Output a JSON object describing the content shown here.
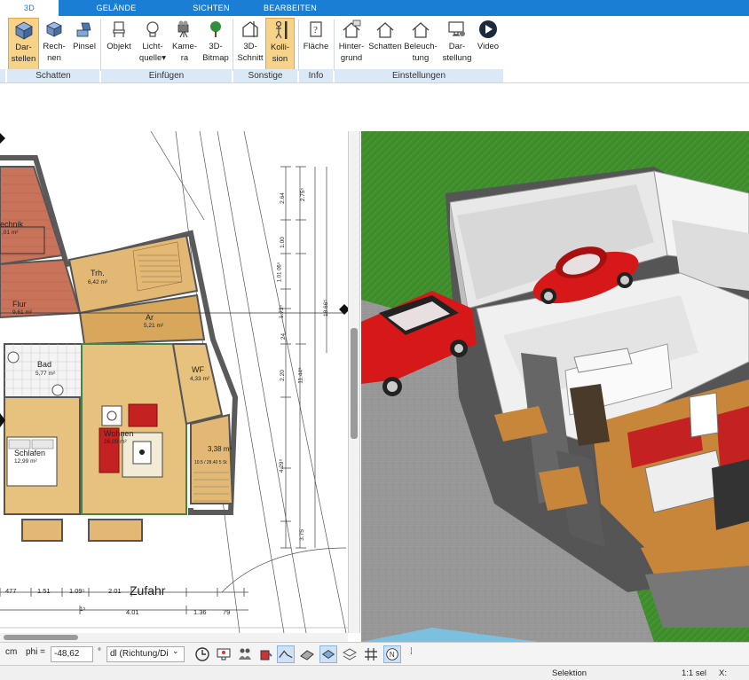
{
  "tabs": [
    {
      "label": "3D",
      "active": true
    },
    {
      "label": "GELÄNDE"
    },
    {
      "label": "SICHTEN"
    },
    {
      "label": "BEARBEITEN"
    }
  ],
  "ribbon": {
    "buttons": [
      {
        "label1": "Dar-",
        "label2": "stellen",
        "icon": "cube-icon",
        "selected": true
      },
      {
        "label1": "Rech-",
        "label2": "nen",
        "icon": "cube-render-icon"
      },
      {
        "label1": "Pinsel",
        "label2": "",
        "icon": "brush-icon"
      },
      {
        "label1": "Objekt",
        "label2": "",
        "icon": "chair-icon"
      },
      {
        "label1": "Licht-",
        "label2": "quelle",
        "icon": "lightbulb-icon"
      },
      {
        "label1": "Kame-",
        "label2": "ra",
        "icon": "camera-icon"
      },
      {
        "label1": "3D-",
        "label2": "Bitmap",
        "icon": "tree-icon"
      },
      {
        "label1": "3D-",
        "label2": "Schnitt",
        "icon": "section-icon"
      },
      {
        "label1": "Kolli-",
        "label2": "sion",
        "icon": "person-collision-icon",
        "selected": true
      },
      {
        "label1": "Fläche",
        "label2": "",
        "icon": "area-info-icon"
      },
      {
        "label1": "Hinter-",
        "label2": "grund",
        "icon": "house-background-icon"
      },
      {
        "label1": "Schatten",
        "label2": "",
        "icon": "house-shadow-icon"
      },
      {
        "label1": "Beleuch-",
        "label2": "tung",
        "icon": "house-light-icon"
      },
      {
        "label1": "Dar-",
        "label2": "stellung",
        "icon": "monitor-settings-icon"
      },
      {
        "label1": "Video",
        "label2": "",
        "icon": "play-icon"
      }
    ],
    "groups": [
      "Schatten",
      "Einfügen",
      "Sonstige",
      "Info",
      "Einstellungen"
    ]
  },
  "plan": {
    "rooms": [
      {
        "name": "echnik",
        "area": ",01 m²"
      },
      {
        "name": "Trh.",
        "area": "6,42 m²"
      },
      {
        "name": "Flur",
        "area": "9,61 m²"
      },
      {
        "name": "Ar",
        "area": "5,21 m²"
      },
      {
        "name": "Bad",
        "area": "5,77 m²"
      },
      {
        "name": "WF",
        "area": "4,33 m²"
      },
      {
        "name": "Wohnen",
        "area": "26,00 m²"
      },
      {
        "name": "Schlafen",
        "area": "12,99 m²"
      },
      {
        "name": "3,38 m²",
        "area": ""
      }
    ],
    "zufahrt_label": "Zufahr",
    "dims_bottom": [
      "477",
      "1.51",
      "1.09⁵",
      "2.01",
      "1.36",
      "79",
      "4.01",
      "1⁵"
    ],
    "dims_right": [
      "2.64",
      "2.75⁵",
      "1.00",
      "1.01 06⁵",
      "1.73⁵",
      "24",
      "2.20",
      "11.44⁵",
      "4.29⁵",
      "3.75",
      "18.66⁵"
    ],
    "stair_label": "10.5 / 28.40 5 St"
  },
  "bottombar": {
    "unit": "cm",
    "phi_label": "phi =",
    "phi_value": "-48,62",
    "degree": "°",
    "direction_value": "dl (Richtung/Di",
    "pin_icon": "pin-icon"
  },
  "status": {
    "mode": "Selektion",
    "sel": "1:1 sel",
    "x_label": "X:"
  },
  "colors": {
    "accent": "#1a7fd4",
    "ribbon_selected": "#f7d38a",
    "grass": "#3c8a2a",
    "car": "#d61818"
  }
}
